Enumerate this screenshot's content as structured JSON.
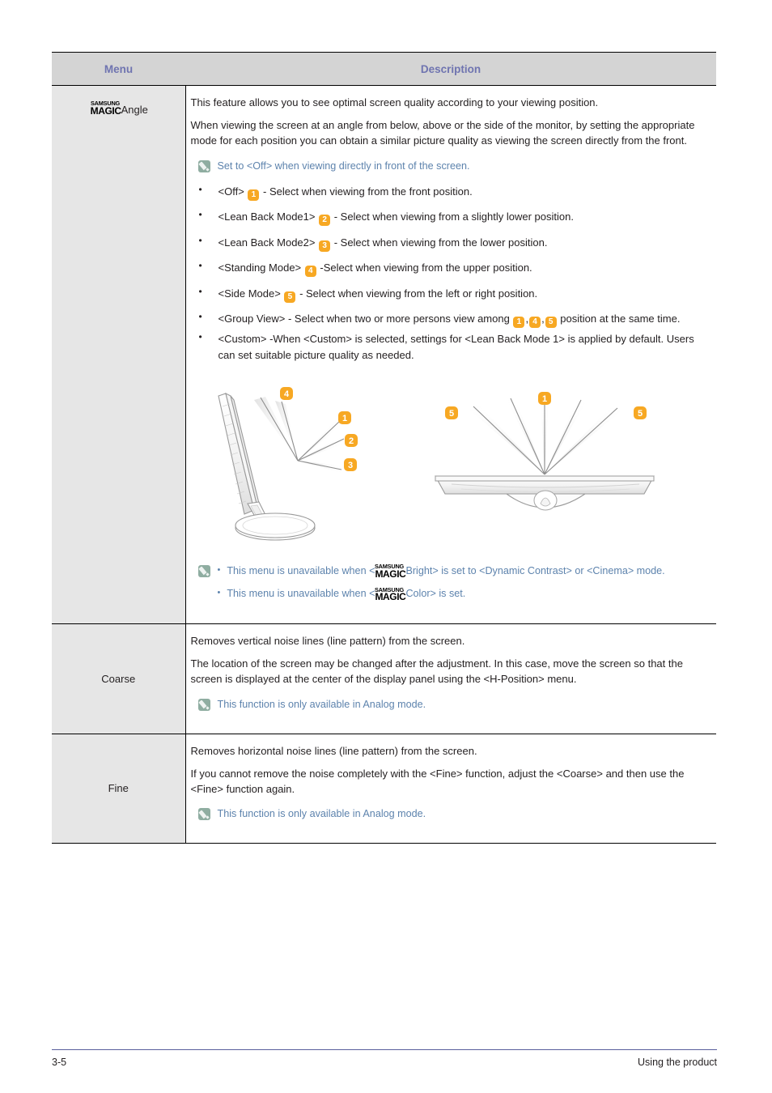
{
  "table": {
    "headers": {
      "menu": "Menu",
      "description": "Description"
    },
    "rows": [
      {
        "menu_logo": {
          "line1": "SAMSUNG",
          "line2": "MAGIC"
        },
        "menu_label": "Angle",
        "paragraphs": [
          "This feature allows you to see optimal screen quality according to your viewing position.",
          "When viewing the screen at an angle from below, above or the side of the monitor, by setting the appropriate mode for each position you can obtain a similar picture quality as viewing the screen directly from the front."
        ],
        "note_top": "Set to <Off> when viewing directly in front of the screen.",
        "bullets": [
          {
            "pre": "<Off> ",
            "badge": "1",
            "post": " - Select when viewing from the front position."
          },
          {
            "pre": "<Lean Back Mode1> ",
            "badge": "2",
            "post": " - Select when viewing from a slightly lower position."
          },
          {
            "pre": "<Lean Back Mode2> ",
            "badge": "3",
            "post": " - Select when viewing from the lower position."
          },
          {
            "pre": "<Standing Mode> ",
            "badge": "4",
            "post": " -Select when viewing from the upper position."
          },
          {
            "pre": "<Side Mode> ",
            "badge": "5",
            "post": " - Select when viewing from the left or right position."
          }
        ],
        "group_view": {
          "pre": "<Group View>  - Select when two or more persons view among ",
          "badges": [
            "1",
            "4",
            "5"
          ],
          "post": " position at the same time."
        },
        "custom_bullet": " <Custom> -When <Custom> is selected, settings for <Lean Back Mode 1> is applied by default. Users can set suitable picture quality as needed.",
        "figure": {
          "left_badges": [
            "4",
            "1",
            "2",
            "3"
          ],
          "right_badges": [
            "5",
            "1",
            "5"
          ]
        },
        "note_bottom": [
          {
            "pre": "This menu is unavailable when <",
            "logo": {
              "line1": "SAMSUNG",
              "line2": "MAGIC"
            },
            "post": "Bright> is set to <Dynamic Contrast> or <Cinema> mode."
          },
          {
            "pre": "This menu is unavailable when <",
            "logo": {
              "line1": "SAMSUNG",
              "line2": "MAGIC"
            },
            "post": "Color> is set."
          }
        ]
      },
      {
        "menu_label": "Coarse",
        "paragraphs": [
          "Removes vertical noise lines (line pattern) from the screen.",
          "The location of the screen may be changed after the adjustment. In this case, move the screen so that the screen is displayed at the center of the display panel using the <H-Position> menu."
        ],
        "note": "This function is only available in Analog mode."
      },
      {
        "menu_label": "Fine",
        "paragraphs": [
          "Removes horizontal noise lines (line pattern) from the screen.",
          "If you cannot remove the noise completely with the <Fine> function, adjust the <Coarse> and then use the <Fine> function again."
        ],
        "note": "This function is only available in Analog mode."
      }
    ]
  },
  "footer": {
    "page_number": "3-5",
    "section": "Using the product"
  },
  "colors": {
    "header_text": "#6f74b0",
    "header_bg": "#d4d4d4",
    "menu_bg": "#e6e6e6",
    "note_text": "#5d83ad",
    "note_icon_bg": "#8fada1",
    "badge_bg": "#f7a823",
    "body_text": "#231f20",
    "footer_rule": "#5a5f9c"
  }
}
